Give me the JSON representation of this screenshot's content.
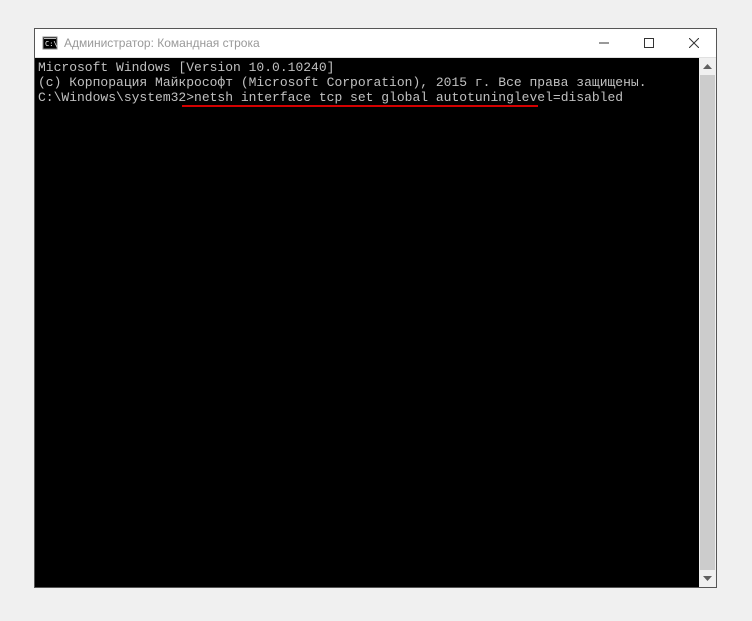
{
  "window": {
    "title": "Администратор: Командная строка"
  },
  "terminal": {
    "line1": "Microsoft Windows [Version 10.0.10240]",
    "line2": "(c) Корпорация Майкрософт (Microsoft Corporation), 2015 г. Все права защищены.",
    "blank": "",
    "prompt_prefix": "C:\\Windows\\system32>",
    "command": "netsh interface tcp set global autotuninglevel=disabled"
  }
}
